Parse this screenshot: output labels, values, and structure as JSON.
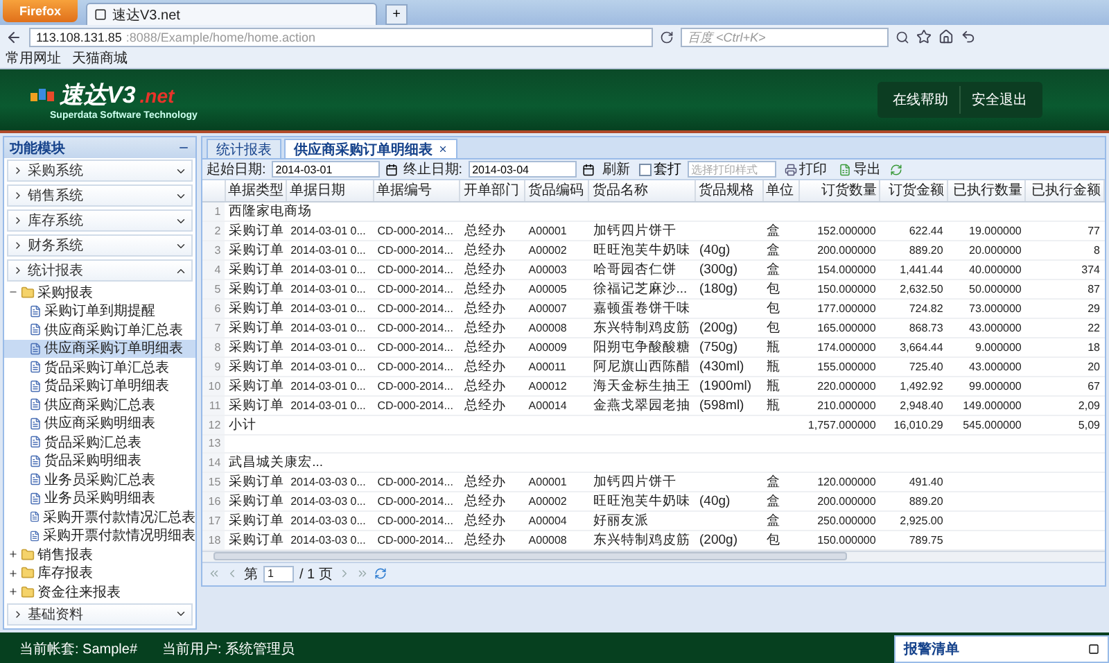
{
  "browser": {
    "menu_button": "Firefox",
    "tab_title": "速达V3.net",
    "new_tab": "+",
    "url_host": "113.108.131.85",
    "url_path": ":8088/Example/home/home.action",
    "search_placeholder": "百度 <Ctrl+K>",
    "bookmarks": [
      "常用网址",
      "天猫商城"
    ]
  },
  "header": {
    "logo_main": "速达V3",
    "logo_suffix": ".net",
    "tagline": "Superdata Software Technology",
    "buttons": [
      "在线帮助",
      "安全退出"
    ]
  },
  "sidebar": {
    "title": "功能模块",
    "modules": [
      {
        "label": "采购系统",
        "expanded": false
      },
      {
        "label": "销售系统",
        "expanded": false
      },
      {
        "label": "库存系统",
        "expanded": false
      },
      {
        "label": "财务系统",
        "expanded": false
      },
      {
        "label": "统计报表",
        "expanded": true,
        "tree": [
          {
            "label": "采购报表",
            "expanded": true,
            "children": [
              {
                "label": "采购订单到期提醒",
                "selected": false
              },
              {
                "label": "供应商采购订单汇总表",
                "selected": false
              },
              {
                "label": "供应商采购订单明细表",
                "selected": true
              },
              {
                "label": "货品采购订单汇总表",
                "selected": false
              },
              {
                "label": "货品采购订单明细表",
                "selected": false
              },
              {
                "label": "供应商采购汇总表",
                "selected": false
              },
              {
                "label": "供应商采购明细表",
                "selected": false
              },
              {
                "label": "货品采购汇总表",
                "selected": false
              },
              {
                "label": "货品采购明细表",
                "selected": false
              },
              {
                "label": "业务员采购汇总表",
                "selected": false
              },
              {
                "label": "业务员采购明细表",
                "selected": false
              },
              {
                "label": "采购开票付款情况汇总表",
                "selected": false
              },
              {
                "label": "采购开票付款情况明细表",
                "selected": false
              }
            ]
          },
          {
            "label": "销售报表",
            "expanded": false
          },
          {
            "label": "库存报表",
            "expanded": false
          },
          {
            "label": "资金往来报表",
            "expanded": false
          }
        ]
      },
      {
        "label": "基础资料",
        "expanded": false
      }
    ]
  },
  "tabs": [
    {
      "label": "统计报表",
      "selected": false
    },
    {
      "label": "供应商采购订单明细表",
      "selected": true
    }
  ],
  "toolbar": {
    "start_label": "起始日期:",
    "start_value": "2014-03-01",
    "end_label": "终止日期:",
    "end_value": "2014-03-04",
    "refresh": "刷新",
    "overprint": {
      "label": "套打",
      "checked": false
    },
    "style_placeholder": "选择打印样式",
    "print": "打印",
    "export": "导出"
  },
  "table": {
    "columns": [
      "单据类型",
      "单据日期",
      "单据编号",
      "开单部门",
      "货品编码",
      "货品名称",
      "货品规格",
      "单位",
      "订货数量",
      "订货金额",
      "已执行数量",
      "已执行金额"
    ],
    "rows": [
      {
        "num": "1",
        "kind": "group",
        "label": "西隆家电商场"
      },
      {
        "num": "2",
        "kind": "item",
        "cells": [
          "采购订单",
          "2014-03-01 0...",
          "CD-000-2014...",
          "总经办",
          "A00001",
          "加钙四片饼干",
          "",
          "盒",
          "152.000000",
          "622.44",
          "19.000000",
          "77"
        ]
      },
      {
        "num": "3",
        "kind": "item",
        "cells": [
          "采购订单",
          "2014-03-01 0...",
          "CD-000-2014...",
          "总经办",
          "A00002",
          "旺旺泡芙牛奶味",
          "(40g)",
          "盒",
          "200.000000",
          "889.20",
          "20.000000",
          "8"
        ]
      },
      {
        "num": "4",
        "kind": "item",
        "cells": [
          "采购订单",
          "2014-03-01 0...",
          "CD-000-2014...",
          "总经办",
          "A00003",
          "哈哥园杏仁饼",
          "(300g)",
          "盒",
          "154.000000",
          "1,441.44",
          "40.000000",
          "374"
        ]
      },
      {
        "num": "5",
        "kind": "item",
        "cells": [
          "采购订单",
          "2014-03-01 0...",
          "CD-000-2014...",
          "总经办",
          "A00005",
          "徐福记芝麻沙...",
          "(180g)",
          "包",
          "150.000000",
          "2,632.50",
          "50.000000",
          "87"
        ]
      },
      {
        "num": "6",
        "kind": "item",
        "cells": [
          "采购订单",
          "2014-03-01 0...",
          "CD-000-2014...",
          "总经办",
          "A00007",
          "嘉顿蛋卷饼干味",
          "",
          "包",
          "177.000000",
          "724.82",
          "73.000000",
          "29"
        ]
      },
      {
        "num": "7",
        "kind": "item",
        "cells": [
          "采购订单",
          "2014-03-01 0...",
          "CD-000-2014...",
          "总经办",
          "A00008",
          "东兴特制鸡皮筋",
          "(200g)",
          "包",
          "165.000000",
          "868.73",
          "43.000000",
          "22"
        ]
      },
      {
        "num": "8",
        "kind": "item",
        "cells": [
          "采购订单",
          "2014-03-01 0...",
          "CD-000-2014...",
          "总经办",
          "A00009",
          "阳朔屯争酸酸糖",
          "(750g)",
          "瓶",
          "174.000000",
          "3,664.44",
          "9.000000",
          "18"
        ]
      },
      {
        "num": "9",
        "kind": "item",
        "cells": [
          "采购订单",
          "2014-03-01 0...",
          "CD-000-2014...",
          "总经办",
          "A00011",
          "阿尼旗山西陈醋",
          "(430ml)",
          "瓶",
          "155.000000",
          "725.40",
          "43.000000",
          "20"
        ]
      },
      {
        "num": "10",
        "kind": "item",
        "cells": [
          "采购订单",
          "2014-03-01 0...",
          "CD-000-2014...",
          "总经办",
          "A00012",
          "海天金标生抽王",
          "(1900ml)",
          "瓶",
          "220.000000",
          "1,492.92",
          "99.000000",
          "67"
        ]
      },
      {
        "num": "11",
        "kind": "item",
        "cells": [
          "采购订单",
          "2014-03-01 0...",
          "CD-000-2014...",
          "总经办",
          "A00014",
          "金燕戈翠园老抽",
          "(598ml)",
          "瓶",
          "210.000000",
          "2,948.40",
          "149.000000",
          "2,09"
        ]
      },
      {
        "num": "12",
        "kind": "subtotal",
        "label": "小计",
        "totals": [
          "1,757.000000",
          "16,010.29",
          "545.000000",
          "5,09"
        ]
      },
      {
        "num": "13",
        "kind": "blank"
      },
      {
        "num": "14",
        "kind": "group",
        "label": "武昌城关康宏..."
      },
      {
        "num": "15",
        "kind": "item",
        "cells": [
          "采购订单",
          "2014-03-03 0...",
          "CD-000-2014...",
          "总经办",
          "A00001",
          "加钙四片饼干",
          "",
          "盒",
          "120.000000",
          "491.40"
        ]
      },
      {
        "num": "16",
        "kind": "item",
        "cells": [
          "采购订单",
          "2014-03-03 0...",
          "CD-000-2014...",
          "总经办",
          "A00002",
          "旺旺泡芙牛奶味",
          "(40g)",
          "盒",
          "200.000000",
          "889.20"
        ]
      },
      {
        "num": "17",
        "kind": "item",
        "cells": [
          "采购订单",
          "2014-03-03 0...",
          "CD-000-2014...",
          "总经办",
          "A00004",
          "好丽友派",
          "",
          "盒",
          "250.000000",
          "2,925.00"
        ]
      },
      {
        "num": "18",
        "kind": "item",
        "cells": [
          "采购订单",
          "2014-03-03 0...",
          "CD-000-2014...",
          "总经办",
          "A00008",
          "东兴特制鸡皮筋",
          "(200g)",
          "包",
          "150.000000",
          "789.75"
        ]
      }
    ]
  },
  "pager": {
    "page_prefix": "第",
    "page_value": "1",
    "page_total": "/ 1 页"
  },
  "status_bar": {
    "account": "当前帐套: Sample#",
    "user": "当前用户: 系统管理员"
  },
  "alert_panel": {
    "title": "报警清单"
  }
}
